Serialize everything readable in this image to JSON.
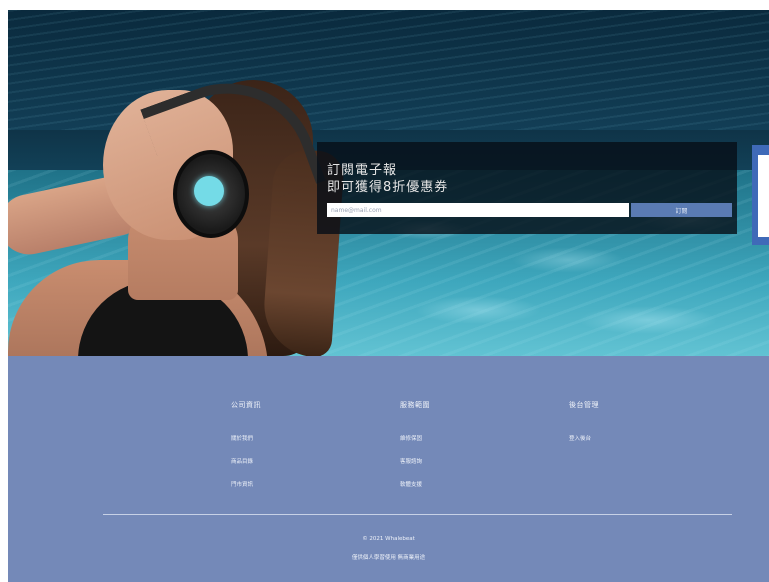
{
  "hero": {
    "subscribe": {
      "title_line1": "訂閱電子報",
      "title_line2": "即可獲得8折優惠券",
      "email_placeholder": "name@mail.com",
      "submit_label": "訂閱"
    }
  },
  "footer": {
    "columns": [
      {
        "heading": "公司資訊",
        "links": [
          "關於我們",
          "商品目錄",
          "門市資訊"
        ]
      },
      {
        "heading": "服務範圍",
        "links": [
          "維修保固",
          "客服諮詢",
          "軟體支援"
        ]
      },
      {
        "heading": "後台管理",
        "links": [
          "登入後台"
        ]
      }
    ],
    "copyright": "© 2021 Whalebeat",
    "notice": "僅供個人學習使用 無商業用途"
  },
  "colors": {
    "footer_bg": "#7489b8",
    "submit_button": "#5a7bb3",
    "side_tab": "#3f6ab8"
  }
}
